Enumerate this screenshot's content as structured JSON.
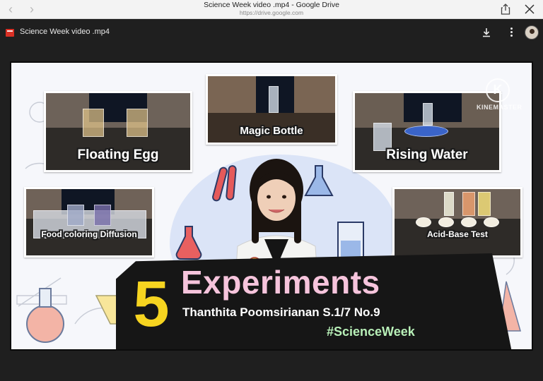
{
  "browser": {
    "title": "Science Week video .mp4 - Google Drive",
    "url": "https://drive.google.com",
    "back_icon": "chevron-left-icon",
    "forward_icon": "chevron-right-icon",
    "share_icon": "share-icon",
    "close_icon": "close-icon"
  },
  "viewer": {
    "file_name": "Science Week video .mp4",
    "file_icon": "video-file-icon",
    "download_icon": "download-icon",
    "more_icon": "more-vertical-icon",
    "avatar_icon": "user-avatar"
  },
  "video": {
    "watermark": "KINEMASTER",
    "experiments": [
      {
        "label": "Floating Egg"
      },
      {
        "label": "Magic Bottle"
      },
      {
        "label": "Rising Water"
      },
      {
        "label": "Food coloring Diffusion"
      },
      {
        "label": "Acid-Base Test"
      }
    ],
    "title_number": "5",
    "title_word": "Experiments",
    "author_line": "Thanthita Poomsirianan S.1/7 No.9",
    "hashtag": "#ScienceWeek"
  },
  "colors": {
    "drive_header": "#1f1f1f",
    "file_icon": "#d93025",
    "title_number": "#f6d420",
    "title_word": "#f6c4dc",
    "hashtag": "#b8f0b8"
  }
}
